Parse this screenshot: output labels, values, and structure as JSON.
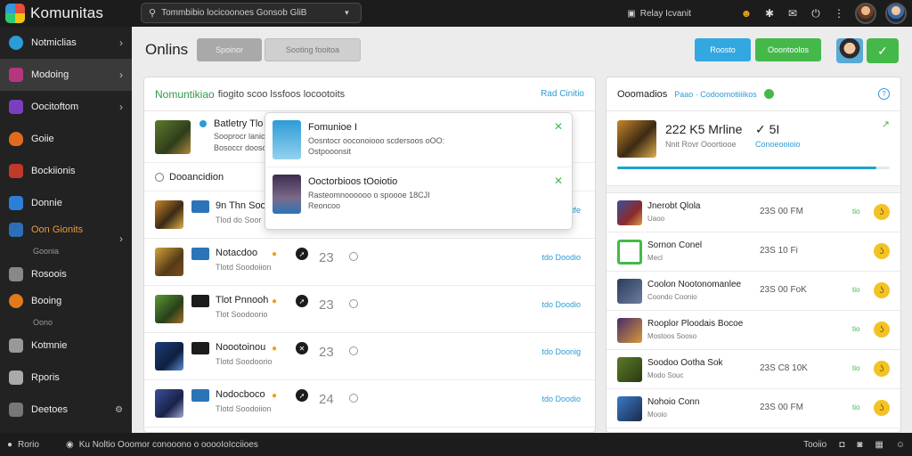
{
  "app": {
    "name": "Komunitas"
  },
  "search": {
    "value": "Tommbibio locicoonoes Gonsob GliB"
  },
  "topbar": {
    "status_text": "Relay Icvanit"
  },
  "sidebar": {
    "items": [
      {
        "label": "Notmiclias",
        "icon": "globe-icon"
      },
      {
        "label": "Modoing",
        "icon": "game-icon"
      },
      {
        "label": "Oocitoftom",
        "icon": "puzzle-icon"
      },
      {
        "label": "Goiie",
        "icon": "flame-icon"
      },
      {
        "label": "Bockiionis",
        "icon": "controller-icon"
      },
      {
        "label": "Donnie",
        "icon": "shield-icon"
      },
      {
        "label": "Oon Gionits",
        "sub": "Goonia",
        "icon": "flag-icon"
      },
      {
        "label": "Rosoois",
        "icon": "chart-icon"
      },
      {
        "label": "Booing",
        "sub": "Oono",
        "icon": "orb-icon"
      },
      {
        "label": "Kotmnie",
        "icon": "bag-icon"
      },
      {
        "label": "Rporis",
        "icon": "doc-icon"
      },
      {
        "label": "Deetoes",
        "icon": "settings-icon"
      }
    ]
  },
  "header": {
    "title": "Onlins",
    "btn1": "Spoinor",
    "btn2": "Sooting fooitoa",
    "blue_btn": "Roosto",
    "green_btn": "Ooontoolos",
    "check_btn": "✓"
  },
  "left_panel": {
    "title": "Nomuntikiao",
    "desc": "fiogito scoo lssfoos locootoits",
    "link": "Rad Cinitio",
    "featured": {
      "title": "Batletry Tlo",
      "line1": "Sooprocr lanio",
      "line2": "Bosoccr doosoe"
    },
    "section": "Dooancidion",
    "rows": [
      {
        "title": "9n Thn Sooio",
        "sub": "Tlod do Soor",
        "num": "",
        "link": "Tiotfe"
      },
      {
        "title": "Notacdoo",
        "sub": "Tlotd Soodoiion",
        "num": "23",
        "link": "tdo Doodio"
      },
      {
        "title": "Tlot Pnnooh",
        "sub": "Tlot Soodoorio",
        "num": "23",
        "link": "tdo Doodio"
      },
      {
        "title": "Noootoinou",
        "sub": "Tlotd Soodoorio",
        "num": "23",
        "link": "tdo Doonig"
      },
      {
        "title": "Nodocboco",
        "sub": "Tlotd Soodoiion",
        "num": "24",
        "link": "tdo Doodio"
      }
    ]
  },
  "popup": {
    "items": [
      {
        "title": "Fomunioe I",
        "line1": "Oosntocr ooconoiooo scdersoos oOO:",
        "line2": "Ostpooonsit"
      },
      {
        "title": "Ooctorbioos tOoiotio",
        "line1": "Rasteomnoooooo o spoooe 18CJI",
        "line2": "Reoncoo"
      }
    ]
  },
  "right_panel": {
    "title": "Ooomadios",
    "sub": "Paao · Codoomotiiiikos",
    "featured": {
      "stat1": "222  K5  Mrline",
      "stat1_label": "Nnit  Rovr  Ooortiooe",
      "stat2": "✓  5I",
      "stat2_label": "Conoeooioio",
      "progress": 0.95
    },
    "rows": [
      {
        "name": "Jnerobt Qlola",
        "desc": "Uaoo",
        "stat": "23S   00  FM",
        "tag": "tio"
      },
      {
        "name": "Sornon Conel",
        "desc": "Mecl",
        "stat": "23S   10  Fi",
        "tag": ""
      },
      {
        "name": "Coolon Nootonomanlee",
        "desc": "Coondo Coonio",
        "stat": "23S   00  FoK",
        "tag": "tio"
      },
      {
        "name": "Rooplor Ploodais Bocoe",
        "desc": "Mostoos Sooso",
        "stat": "",
        "tag": "tio"
      },
      {
        "name": "Soodoo Ootha   Sok",
        "desc": "Modo Souc",
        "stat": "23S   C8  10K",
        "tag": "tio"
      },
      {
        "name": "Nohoio Conn",
        "desc": "Mooio",
        "stat": "23S   00  FM",
        "tag": "tio"
      }
    ]
  },
  "statusbar": {
    "left": "Rorio",
    "message": "Ku Noltio Ooomor conooono o ooooIoIcciioes",
    "right": "Tooiio"
  }
}
